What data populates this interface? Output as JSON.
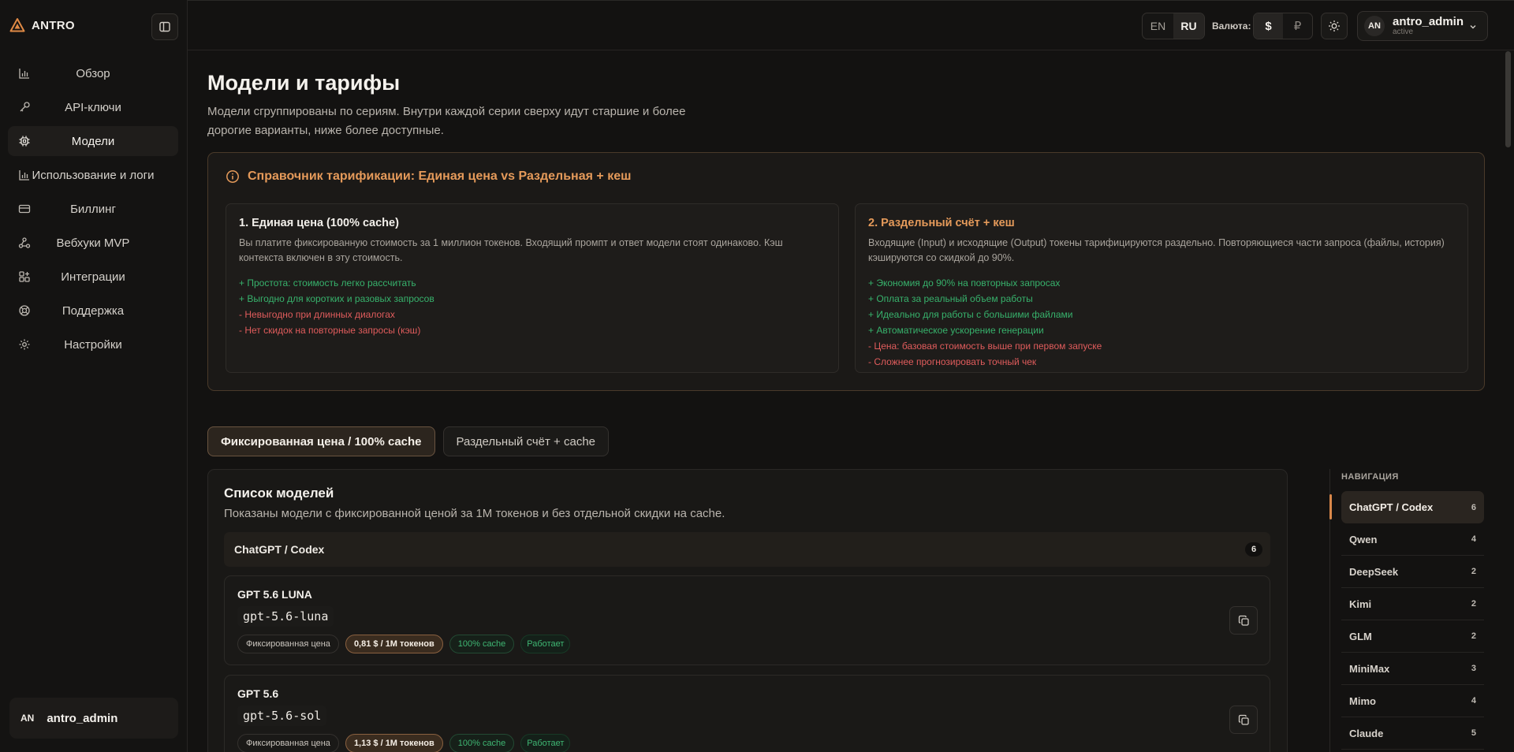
{
  "brand": {
    "name": "ANTRO"
  },
  "sidebar": {
    "items": [
      {
        "label": "Обзор",
        "icon": "chart-bar-icon",
        "active": false
      },
      {
        "label": "API-ключи",
        "icon": "key-icon",
        "active": false
      },
      {
        "label": "Модели",
        "icon": "cpu-chip-icon",
        "active": true
      },
      {
        "label": "Использование и логи",
        "icon": "chart-bar-icon",
        "active": false
      },
      {
        "label": "Биллинг",
        "icon": "credit-card-icon",
        "active": false
      },
      {
        "label": "Вебхуки MVP",
        "icon": "webhook-icon",
        "active": false
      },
      {
        "label": "Интеграции",
        "icon": "puzzle-grid-icon",
        "active": false
      },
      {
        "label": "Поддержка",
        "icon": "lifebuoy-icon",
        "active": false
      },
      {
        "label": "Настройки",
        "icon": "gear-icon",
        "active": false
      }
    ],
    "user": {
      "initials": "AN",
      "name": "antro_admin"
    }
  },
  "topbar": {
    "languages": [
      "EN",
      "RU"
    ],
    "active_language": "RU",
    "currency_label": "Валюта:",
    "currencies": [
      "$",
      "₽"
    ],
    "active_currency": "$",
    "user": {
      "initials": "AN",
      "name": "antro_admin",
      "status": "active"
    }
  },
  "page": {
    "title": "Модели и тарифы",
    "subtitle": "Модели сгруппированы по сериям. Внутри каждой серии сверху идут старшие и более дорогие варианты, ниже более доступные."
  },
  "pricing_reference": {
    "title": "Справочник тарификации: Единая цена vs Раздельная + кеш",
    "cards": [
      {
        "title": "1. Единая цена (100% cache)",
        "description": "Вы платите фиксированную стоимость за 1 миллион токенов. Входящий промпт и ответ модели стоят одинаково. Кэш контекста включен в эту стоимость.",
        "pros": [
          "+ Простота: стоимость легко рассчитать",
          "+ Выгодно для коротких и разовых запросов"
        ],
        "cons": [
          "- Невыгодно при длинных диалогах",
          "- Нет скидок на повторные запросы (кэш)"
        ]
      },
      {
        "title": "2. Раздельный счёт + кеш",
        "description": "Входящие (Input) и исходящие (Output) токены тарифицируются раздельно. Повторяющиеся части запроса (файлы, история) кэшируются со скидкой до 90%.",
        "pros": [
          "+ Экономия до 90% на повторных запросах",
          "+ Оплата за реальный объем работы",
          "+ Идеально для работы с большими файлами",
          "+ Автоматическое ускорение генерации"
        ],
        "cons": [
          "- Цена: базовая стоимость выше при первом запуске",
          "- Сложнее прогнозировать точный чек"
        ]
      }
    ]
  },
  "mode_tabs": [
    {
      "label": "Фиксированная цена / 100% cache",
      "active": true
    },
    {
      "label": "Раздельный счёт + cache",
      "active": false
    }
  ],
  "models": {
    "title": "Список моделей",
    "description": "Показаны модели с фиксированной ценой за 1M токенов и без отдельной скидки на cache.",
    "series": {
      "name": "ChatGPT / Codex",
      "count": "6"
    },
    "items": [
      {
        "name": "GPT 5.6 LUNA",
        "id": "gpt-5.6-luna",
        "pricing_type": "Фиксированная цена",
        "price": "0,81 $ / 1M токенов",
        "cache": "100% cache",
        "status": "Работает"
      },
      {
        "name": "GPT 5.6",
        "id": "gpt-5.6-sol",
        "pricing_type": "Фиксированная цена",
        "price": "1,13 $ / 1M токенов",
        "cache": "100% cache",
        "status": "Работает"
      }
    ]
  },
  "series_nav": {
    "title": "НАВИГАЦИЯ",
    "items": [
      {
        "label": "ChatGPT / Codex",
        "count": "6",
        "active": true
      },
      {
        "label": "Qwen",
        "count": "4",
        "active": false
      },
      {
        "label": "DeepSeek",
        "count": "2",
        "active": false
      },
      {
        "label": "Kimi",
        "count": "2",
        "active": false
      },
      {
        "label": "GLM",
        "count": "2",
        "active": false
      },
      {
        "label": "MiniMax",
        "count": "3",
        "active": false
      },
      {
        "label": "Mimo",
        "count": "4",
        "active": false
      },
      {
        "label": "Claude",
        "count": "5",
        "active": false
      }
    ]
  },
  "colors": {
    "accent": "#e59a5a",
    "positive": "#37b26c",
    "negative": "#e05c5c",
    "background": "#131211"
  }
}
